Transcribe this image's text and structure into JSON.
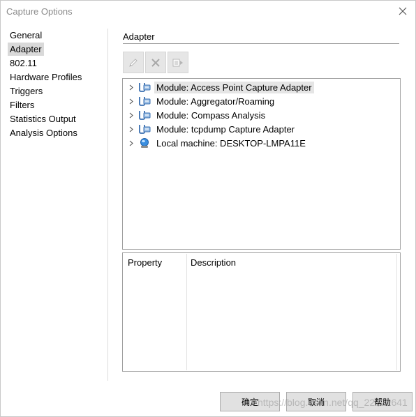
{
  "window": {
    "title": "Capture Options"
  },
  "sidebar": {
    "items": [
      {
        "label": "General",
        "selected": false
      },
      {
        "label": "Adapter",
        "selected": true
      },
      {
        "label": "802.11",
        "selected": false
      },
      {
        "label": "Hardware Profiles",
        "selected": false
      },
      {
        "label": "Triggers",
        "selected": false
      },
      {
        "label": "Filters",
        "selected": false
      },
      {
        "label": "Statistics Output",
        "selected": false
      },
      {
        "label": "Analysis Options",
        "selected": false
      }
    ]
  },
  "adapter": {
    "section_title": "Adapter",
    "toolbar": {
      "icons": [
        "edit-icon",
        "delete-icon",
        "properties-icon"
      ],
      "enabled": false
    },
    "tree": [
      {
        "label": "Module: Access Point Capture Adapter",
        "icon": "module-icon",
        "selected": true
      },
      {
        "label": "Module: Aggregator/Roaming",
        "icon": "module-icon",
        "selected": false
      },
      {
        "label": "Module: Compass Analysis",
        "icon": "module-icon",
        "selected": false
      },
      {
        "label": "Module: tcpdump Capture Adapter",
        "icon": "module-icon",
        "selected": false
      },
      {
        "label": "Local machine: DESKTOP-LMPA11E",
        "icon": "computer-icon",
        "selected": false
      }
    ],
    "properties": {
      "col_property": "Property",
      "col_description": "Description"
    }
  },
  "buttons": {
    "ok": "确定",
    "cancel": "取消",
    "help": "帮助"
  },
  "watermark": "https://blog.csdn.net/qq_22721641"
}
